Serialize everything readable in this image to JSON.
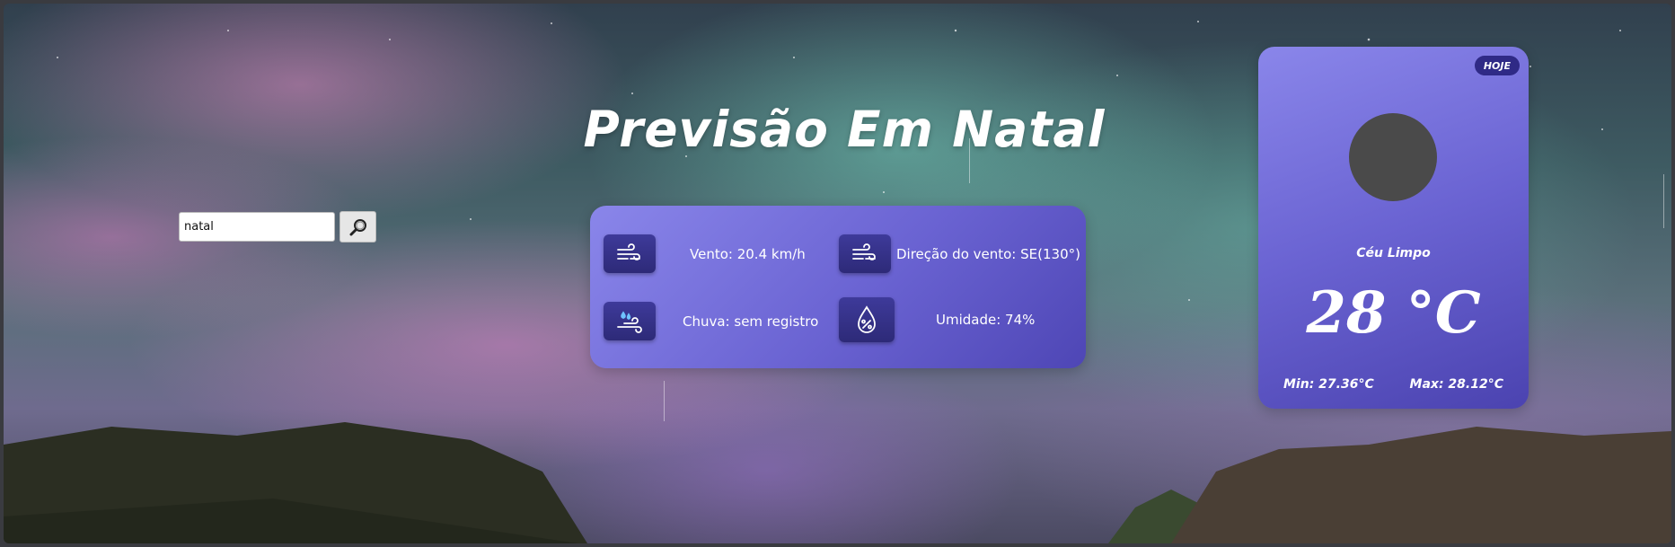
{
  "search": {
    "value": "natal",
    "button_icon": "magnifier-icon"
  },
  "title": "Previsão Em Natal",
  "details": {
    "wind": {
      "label": "Vento: 20.4 km/h",
      "icon": "wind-icon"
    },
    "wind_direction": {
      "label": "Direção do vento: SE(130°)",
      "icon": "wind-icon"
    },
    "rain": {
      "label": "Chuva: sem registro",
      "icon": "rain-wind-icon"
    },
    "humidity": {
      "label": "Umidade: 74%",
      "icon": "humidity-icon"
    }
  },
  "today": {
    "badge": "HOJE",
    "condition": "Céu Limpo",
    "temperature": "28 °C",
    "min": "Min: 27.36°C",
    "max": "Max: 28.12°C"
  },
  "colors": {
    "panel_light": "#8a86ea",
    "panel_dark": "#4e46b5",
    "icon_box": "#2d2a78",
    "badge": "#2f2a86"
  }
}
